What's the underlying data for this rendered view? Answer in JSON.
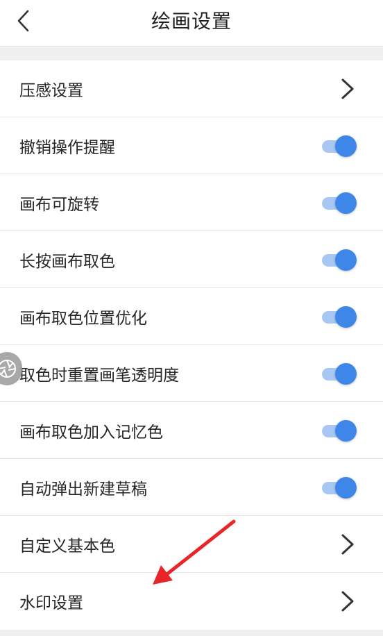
{
  "header": {
    "title": "绘画设置",
    "back_icon": "chevron-left-icon"
  },
  "settings": [
    {
      "label": "压感设置",
      "type": "link"
    },
    {
      "label": "撤销操作提醒",
      "type": "toggle",
      "on": true
    },
    {
      "label": "画布可旋转",
      "type": "toggle",
      "on": true
    },
    {
      "label": "长按画布取色",
      "type": "toggle",
      "on": true
    },
    {
      "label": "画布取色位置优化",
      "type": "toggle",
      "on": true
    },
    {
      "label": "取色时重置画笔透明度",
      "type": "toggle",
      "on": true
    },
    {
      "label": "画布取色加入记忆色",
      "type": "toggle",
      "on": true
    },
    {
      "label": "自动弹出新建草稿",
      "type": "toggle",
      "on": true
    },
    {
      "label": "自定义基本色",
      "type": "link"
    },
    {
      "label": "水印设置",
      "type": "link"
    }
  ],
  "colors": {
    "toggle_on_knob": "#3e86e8",
    "toggle_on_track": "#a8c8f3",
    "annotation_arrow": "#e8262a"
  }
}
